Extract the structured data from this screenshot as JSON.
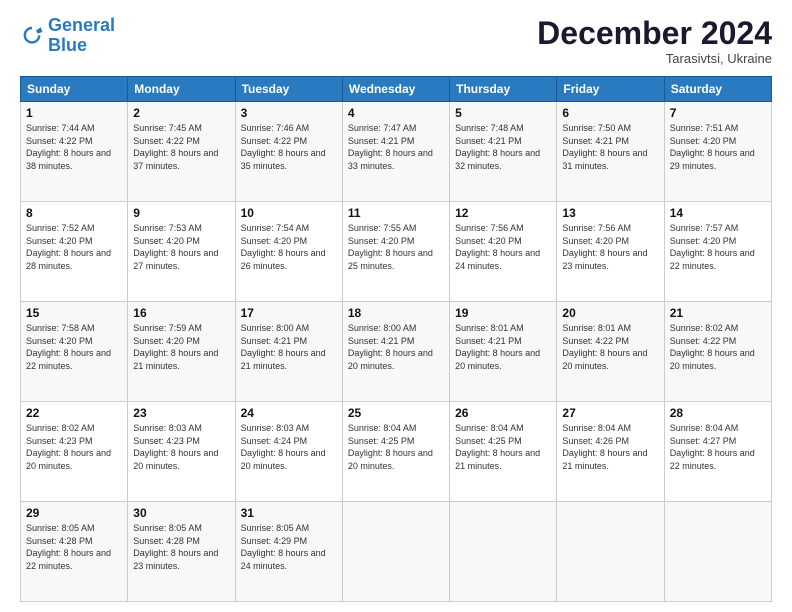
{
  "logo": {
    "line1": "General",
    "line2": "Blue"
  },
  "header": {
    "month": "December 2024",
    "location": "Tarasivtsi, Ukraine"
  },
  "weekdays": [
    "Sunday",
    "Monday",
    "Tuesday",
    "Wednesday",
    "Thursday",
    "Friday",
    "Saturday"
  ],
  "weeks": [
    [
      {
        "day": "1",
        "sunrise": "7:44 AM",
        "sunset": "4:22 PM",
        "daylight": "8 hours and 38 minutes."
      },
      {
        "day": "2",
        "sunrise": "7:45 AM",
        "sunset": "4:22 PM",
        "daylight": "8 hours and 37 minutes."
      },
      {
        "day": "3",
        "sunrise": "7:46 AM",
        "sunset": "4:22 PM",
        "daylight": "8 hours and 35 minutes."
      },
      {
        "day": "4",
        "sunrise": "7:47 AM",
        "sunset": "4:21 PM",
        "daylight": "8 hours and 33 minutes."
      },
      {
        "day": "5",
        "sunrise": "7:48 AM",
        "sunset": "4:21 PM",
        "daylight": "8 hours and 32 minutes."
      },
      {
        "day": "6",
        "sunrise": "7:50 AM",
        "sunset": "4:21 PM",
        "daylight": "8 hours and 31 minutes."
      },
      {
        "day": "7",
        "sunrise": "7:51 AM",
        "sunset": "4:20 PM",
        "daylight": "8 hours and 29 minutes."
      }
    ],
    [
      {
        "day": "8",
        "sunrise": "7:52 AM",
        "sunset": "4:20 PM",
        "daylight": "8 hours and 28 minutes."
      },
      {
        "day": "9",
        "sunrise": "7:53 AM",
        "sunset": "4:20 PM",
        "daylight": "8 hours and 27 minutes."
      },
      {
        "day": "10",
        "sunrise": "7:54 AM",
        "sunset": "4:20 PM",
        "daylight": "8 hours and 26 minutes."
      },
      {
        "day": "11",
        "sunrise": "7:55 AM",
        "sunset": "4:20 PM",
        "daylight": "8 hours and 25 minutes."
      },
      {
        "day": "12",
        "sunrise": "7:56 AM",
        "sunset": "4:20 PM",
        "daylight": "8 hours and 24 minutes."
      },
      {
        "day": "13",
        "sunrise": "7:56 AM",
        "sunset": "4:20 PM",
        "daylight": "8 hours and 23 minutes."
      },
      {
        "day": "14",
        "sunrise": "7:57 AM",
        "sunset": "4:20 PM",
        "daylight": "8 hours and 22 minutes."
      }
    ],
    [
      {
        "day": "15",
        "sunrise": "7:58 AM",
        "sunset": "4:20 PM",
        "daylight": "8 hours and 22 minutes."
      },
      {
        "day": "16",
        "sunrise": "7:59 AM",
        "sunset": "4:20 PM",
        "daylight": "8 hours and 21 minutes."
      },
      {
        "day": "17",
        "sunrise": "8:00 AM",
        "sunset": "4:21 PM",
        "daylight": "8 hours and 21 minutes."
      },
      {
        "day": "18",
        "sunrise": "8:00 AM",
        "sunset": "4:21 PM",
        "daylight": "8 hours and 20 minutes."
      },
      {
        "day": "19",
        "sunrise": "8:01 AM",
        "sunset": "4:21 PM",
        "daylight": "8 hours and 20 minutes."
      },
      {
        "day": "20",
        "sunrise": "8:01 AM",
        "sunset": "4:22 PM",
        "daylight": "8 hours and 20 minutes."
      },
      {
        "day": "21",
        "sunrise": "8:02 AM",
        "sunset": "4:22 PM",
        "daylight": "8 hours and 20 minutes."
      }
    ],
    [
      {
        "day": "22",
        "sunrise": "8:02 AM",
        "sunset": "4:23 PM",
        "daylight": "8 hours and 20 minutes."
      },
      {
        "day": "23",
        "sunrise": "8:03 AM",
        "sunset": "4:23 PM",
        "daylight": "8 hours and 20 minutes."
      },
      {
        "day": "24",
        "sunrise": "8:03 AM",
        "sunset": "4:24 PM",
        "daylight": "8 hours and 20 minutes."
      },
      {
        "day": "25",
        "sunrise": "8:04 AM",
        "sunset": "4:25 PM",
        "daylight": "8 hours and 20 minutes."
      },
      {
        "day": "26",
        "sunrise": "8:04 AM",
        "sunset": "4:25 PM",
        "daylight": "8 hours and 21 minutes."
      },
      {
        "day": "27",
        "sunrise": "8:04 AM",
        "sunset": "4:26 PM",
        "daylight": "8 hours and 21 minutes."
      },
      {
        "day": "28",
        "sunrise": "8:04 AM",
        "sunset": "4:27 PM",
        "daylight": "8 hours and 22 minutes."
      }
    ],
    [
      {
        "day": "29",
        "sunrise": "8:05 AM",
        "sunset": "4:28 PM",
        "daylight": "8 hours and 22 minutes."
      },
      {
        "day": "30",
        "sunrise": "8:05 AM",
        "sunset": "4:28 PM",
        "daylight": "8 hours and 23 minutes."
      },
      {
        "day": "31",
        "sunrise": "8:05 AM",
        "sunset": "4:29 PM",
        "daylight": "8 hours and 24 minutes."
      },
      null,
      null,
      null,
      null
    ]
  ]
}
